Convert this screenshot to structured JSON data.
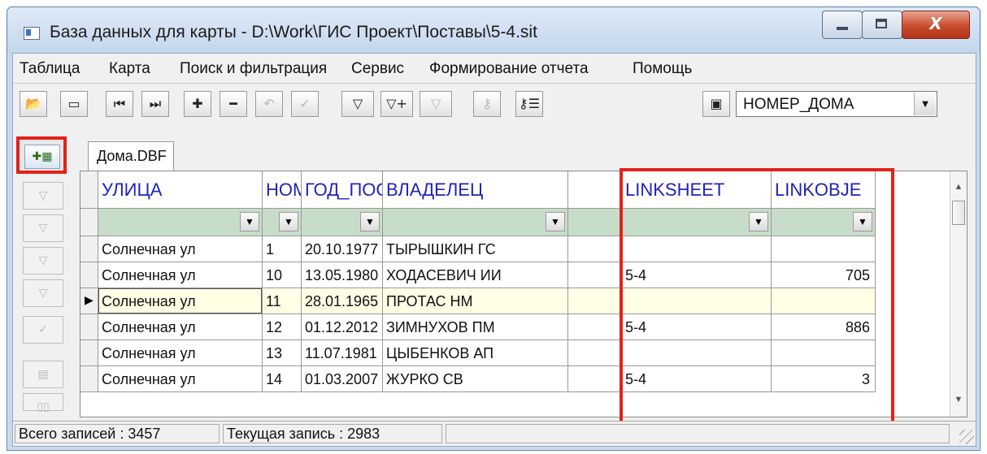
{
  "window": {
    "title": "База данных для карты - D:\\Work\\ГИС Проект\\Поставы\\5-4.sit",
    "close_glyph": "X"
  },
  "menu": [
    "Таблица",
    "Карта",
    "Поиск и фильтрация",
    "Сервис",
    "Формирование отчета",
    "Помощь"
  ],
  "toolbar": {
    "icons": [
      "open-folder-icon",
      "folder-icon",
      "first-record-icon",
      "last-record-icon",
      "add-record-icon",
      "delete-record-icon",
      "undo-icon",
      "apply-icon",
      "filter-icon",
      "add-filter-icon",
      "filter-disabled-icon",
      "key-icon",
      "key-table-icon",
      "map-object-icon"
    ],
    "field_combo_value": "НОМЕР_ДОМА"
  },
  "tab": {
    "label": "Дома.DBF"
  },
  "table": {
    "columns": [
      "УЛИЦА",
      "НОМЕ",
      "ГОД_ПОС",
      "ВЛАДЕЛЕЦ",
      "LINKSHEET",
      "LINKOBJE"
    ],
    "rows": [
      [
        "Солнечная ул",
        "1",
        "20.10.1977",
        "ТЫРЫШКИН ГС",
        "",
        ""
      ],
      [
        "Солнечная ул",
        "10",
        "13.05.1980",
        "ХОДАСЕВИЧ ИИ",
        "5-4",
        "705"
      ],
      [
        "Солнечная ул",
        "11",
        "28.01.1965",
        "ПРОТАС НМ",
        "",
        ""
      ],
      [
        "Солнечная ул",
        "12",
        "01.12.2012",
        "ЗИМНУХОВ ПМ",
        "5-4",
        "886"
      ],
      [
        "Солнечная ул",
        "13",
        "11.07.1981",
        "ЦЫБЕНКОВ АП",
        "",
        ""
      ],
      [
        "Солнечная ул",
        "14",
        "01.03.2007",
        "ЖУРКО СВ",
        "5-4",
        "3"
      ]
    ],
    "selected_row": 2
  },
  "status": {
    "total": "Всего записей : 3457",
    "current": "Текущая запись : 2983"
  },
  "colors": {
    "highlight": "#e32119",
    "filter_row": "#c7ddc9",
    "header_text": "#2222bb",
    "selected_row": "#ffffe6"
  }
}
